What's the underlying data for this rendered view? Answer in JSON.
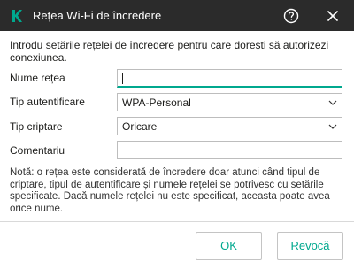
{
  "window": {
    "title": "Rețea Wi-Fi de încredere",
    "logo_icon": "kaspersky-k-logo",
    "help_icon": "help-circle-icon",
    "close_icon": "close-icon"
  },
  "intro_text": "Introdu setările rețelei de încredere pentru care dorești să autorizezi conexiunea.",
  "fields": {
    "network_name": {
      "label": "Nume rețea",
      "value": ""
    },
    "auth_type": {
      "label": "Tip autentificare",
      "value": "WPA-Personal"
    },
    "encryption_type": {
      "label": "Tip criptare",
      "value": "Oricare"
    },
    "comment": {
      "label": "Comentariu",
      "value": ""
    }
  },
  "note_text": "Notă: o rețea este considerată de încredere doar atunci când tipul de criptare, tipul de autentificare și numele rețelei se potrivesc cu setările specificate. Dacă numele rețelei nu este specificat, aceasta poate avea orice nume.",
  "buttons": {
    "ok_label": "OK",
    "cancel_label": "Revocă"
  },
  "colors": {
    "titlebar": "#2b2b2b",
    "accent": "#00a88e",
    "logo": "#00a88e"
  }
}
